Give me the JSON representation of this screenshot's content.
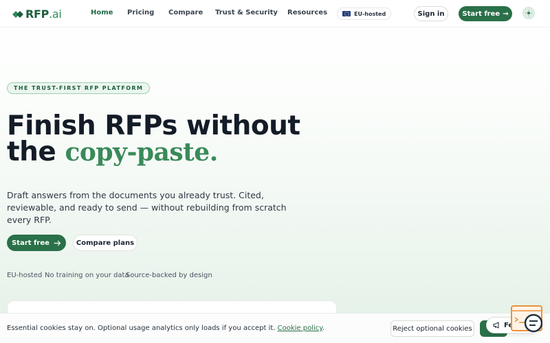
{
  "header": {
    "logo": {
      "text": "RFP",
      "suffix": ".ai"
    },
    "nav": [
      {
        "label": "Home",
        "active": true
      },
      {
        "label": "Pricing"
      },
      {
        "label": "Compare"
      },
      {
        "label": "Trust & Security"
      },
      {
        "label": "Resources"
      }
    ],
    "eu_badge": "EU-hosted",
    "sign_in": "Sign in",
    "start_free": "Start free",
    "arrow": "→"
  },
  "hero": {
    "badge": "THE TRUST-FIRST RFP PLATFORM",
    "headline_line1": "Finish RFPs without",
    "headline_line2_plain": "the ",
    "headline_line2_accent": "copy-paste.",
    "subcopy": "Draft answers from the documents you already trust. Cited, reviewable, and ready to send — without rebuilding from scratch every RFP.",
    "cta_primary": "Start free",
    "cta_secondary": "Compare plans",
    "trust_points": [
      "EU-hosted",
      "No training on your data",
      "Source-backed by design"
    ]
  },
  "cookie_bar": {
    "text": "Essential cookies stay on. Optional usage analytics only loads if you accept it.",
    "link": "Cookie policy",
    "link_suffix": ".",
    "reject": "Reject optional cookies"
  },
  "feedback": {
    "label": "Feedb..."
  },
  "colors": {
    "brand": "#2a7048",
    "accent": "#3a8a59",
    "ink": "#141c27"
  }
}
